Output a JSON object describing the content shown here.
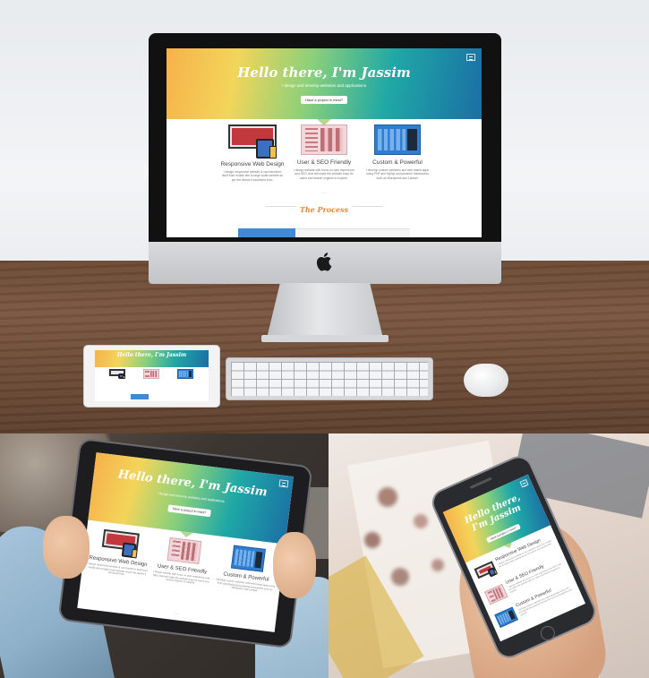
{
  "site": {
    "hero_title": "Hello there, I'm Jassim",
    "hero_subtitle": "I design and develop websites and applications",
    "cta_label": "Have a project in mind?",
    "features": [
      {
        "title": "Responsive Web Design",
        "desc": "I design responsive website & can transform itself from mobile site to large scale website as per the device it accessed from."
      },
      {
        "title": "User & SEO Friendly",
        "desc": "I design website with focus on user experience and SEO, that will make the website easy for users and search engines to explore."
      },
      {
        "title": "Custom & Powerful",
        "desc": "I develop custom websites and web based apps using PHP and MySql and powerful frameworks such as Wordpress and Laravel."
      }
    ],
    "process_heading": "The Process",
    "more_dots": "....."
  },
  "colors": {
    "hero_gradient": [
      "#f6b24a",
      "#f3d55a",
      "#8cd07a",
      "#1fa8a6",
      "#1b6fa5"
    ],
    "process_heading": "#e8873a",
    "process_tab_active": "#3f8ad6"
  },
  "icons": [
    "menu-icon",
    "apple-logo-icon"
  ]
}
